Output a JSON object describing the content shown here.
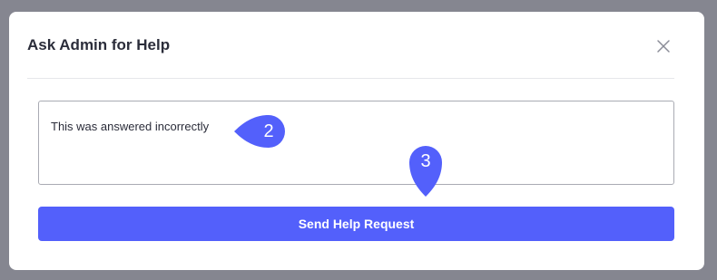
{
  "modal": {
    "title": "Ask Admin for Help",
    "close_icon": "close-icon",
    "message_value": "This was answered incorrectly",
    "send_button_label": "Send Help Request"
  },
  "annotations": [
    {
      "label": "2",
      "shape": "left-pointing-pin",
      "color": "#5360fb"
    },
    {
      "label": "3",
      "shape": "down-pointing-pin",
      "color": "#5360fb"
    }
  ],
  "colors": {
    "backdrop": "#858690",
    "accent": "#5360fb",
    "title_text": "#2b2d3a"
  }
}
